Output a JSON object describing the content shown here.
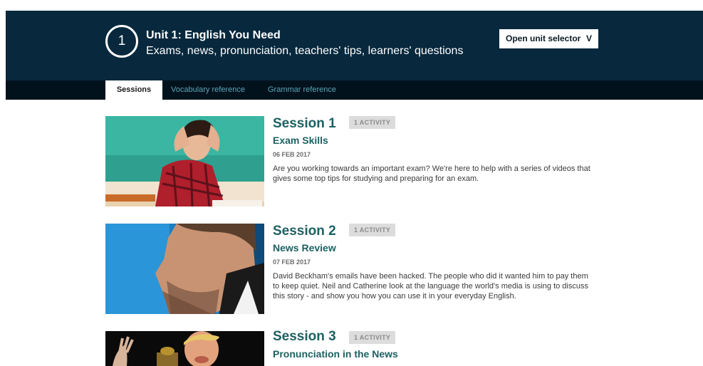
{
  "unit": {
    "number": "1",
    "title": "Unit 1: English You Need",
    "subtitle": "Exams, news, pronunciation, teachers' tips, learners' questions",
    "selector_label": "Open unit selector",
    "selector_icon": "chevron-down-icon",
    "selector_glyph": "V"
  },
  "tabs": [
    {
      "label": "Sessions",
      "active": true
    },
    {
      "label": "Vocabulary reference",
      "active": false
    },
    {
      "label": "Grammar reference",
      "active": false
    }
  ],
  "sessions": [
    {
      "title": "Session 1",
      "badge": "1 ACTIVITY",
      "subtitle": "Exam Skills",
      "date": "06 FEB 2017",
      "description": "Are you working towards an important exam? We're here to help with a series of videos that gives some top tips for studying and preparing for an exam."
    },
    {
      "title": "Session 2",
      "badge": "1 ACTIVITY",
      "subtitle": "News Review",
      "date": "07 FEB 2017",
      "description": "David Beckham's emails have been hacked. The people who did it wanted him to pay them to keep quiet. Neil and Catherine look at the language the world's media is using to discuss this story - and show you how you can use it in your everyday English."
    },
    {
      "title": "Session 3",
      "badge": "1 ACTIVITY",
      "subtitle": "Pronunciation in the News"
    }
  ],
  "colors": {
    "header_bg": "#07283d",
    "tabbar_bg": "#02121d",
    "session_title": "#1c6163",
    "tab_link": "#5aa6b8"
  }
}
